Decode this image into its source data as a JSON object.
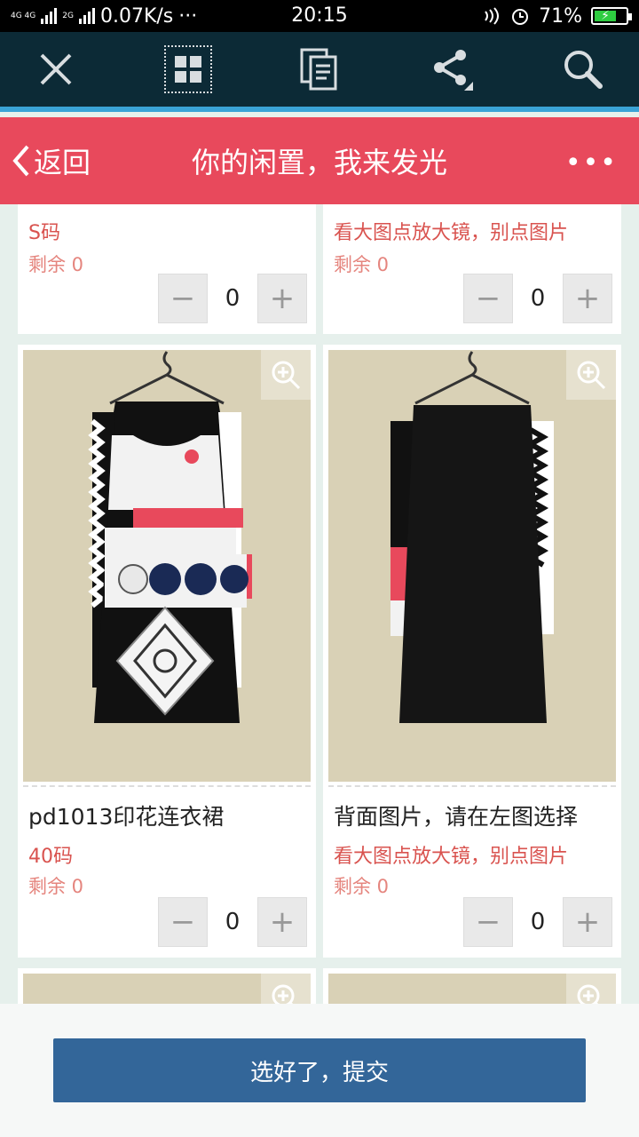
{
  "status_bar": {
    "network_top": "4G 4G",
    "network_bottom": "2G",
    "speed": "0.07K/s",
    "dots": "···",
    "time": "20:15",
    "battery_text": "71%",
    "battery_level": 0.71
  },
  "toolbar": {
    "icons": [
      "close-icon",
      "grid-icon",
      "document-icon",
      "share-icon",
      "search-icon"
    ]
  },
  "header": {
    "back_label": "返回",
    "title": "你的闲置，我来发光",
    "more": "•••"
  },
  "products_top": [
    {
      "size": "S码",
      "remain": "剩余 0",
      "qty": "0"
    },
    {
      "size": "看大图点放大镜，别点图片",
      "remain": "剩余 0",
      "qty": "0"
    }
  ],
  "products": [
    {
      "title": "pd1013印花连衣裙",
      "size": "40码",
      "remain": "剩余 0",
      "qty": "0"
    },
    {
      "title": "背面图片，请在左图选择",
      "size": "看大图点放大镜，别点图片",
      "remain": "剩余 0",
      "qty": "0"
    }
  ],
  "stepper": {
    "minus": "−",
    "plus": "+"
  },
  "submit_label": "选好了，提交",
  "colors": {
    "header": "#e8495c",
    "toolbar": "#0c2a36",
    "accent_line": "#3aa3d6",
    "submit": "#336699",
    "price_red": "#d9534f"
  }
}
